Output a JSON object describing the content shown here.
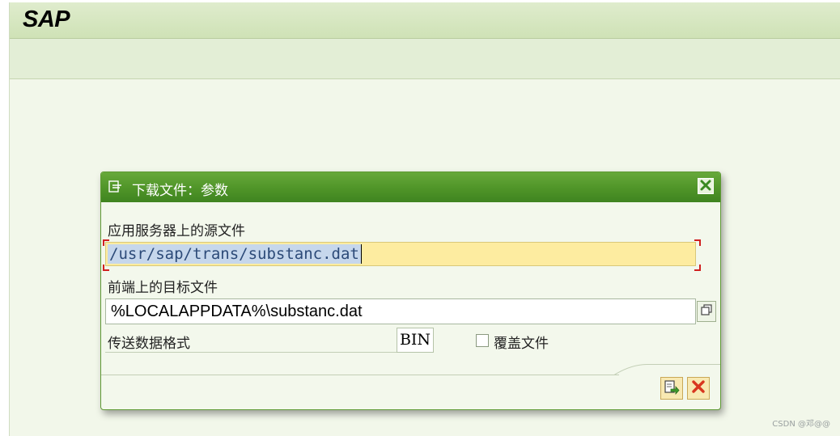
{
  "app": {
    "logo": "SAP"
  },
  "dialog": {
    "title": "下载文件：参数",
    "source_label": "应用服务器上的源文件",
    "source_value": "/usr/sap/trans/substanc.dat",
    "target_label": "前端上的目标文件",
    "target_value": "%LOCALAPPDATA%\\substanc.dat",
    "format_label": "传送数据格式",
    "format_value": "BIN",
    "overwrite_label": "覆盖文件",
    "overwrite_checked": false
  },
  "icons": {
    "dialog": "dialog-icon",
    "close": "close-icon",
    "browse": "browse-icon",
    "confirm": "download-icon",
    "cancel": "cancel-icon"
  },
  "colors": {
    "header_green": "#4f9428",
    "input_yellow": "#fdeca0",
    "cancel_red": "#d8361f"
  },
  "watermark": "CSDN @邓@@"
}
